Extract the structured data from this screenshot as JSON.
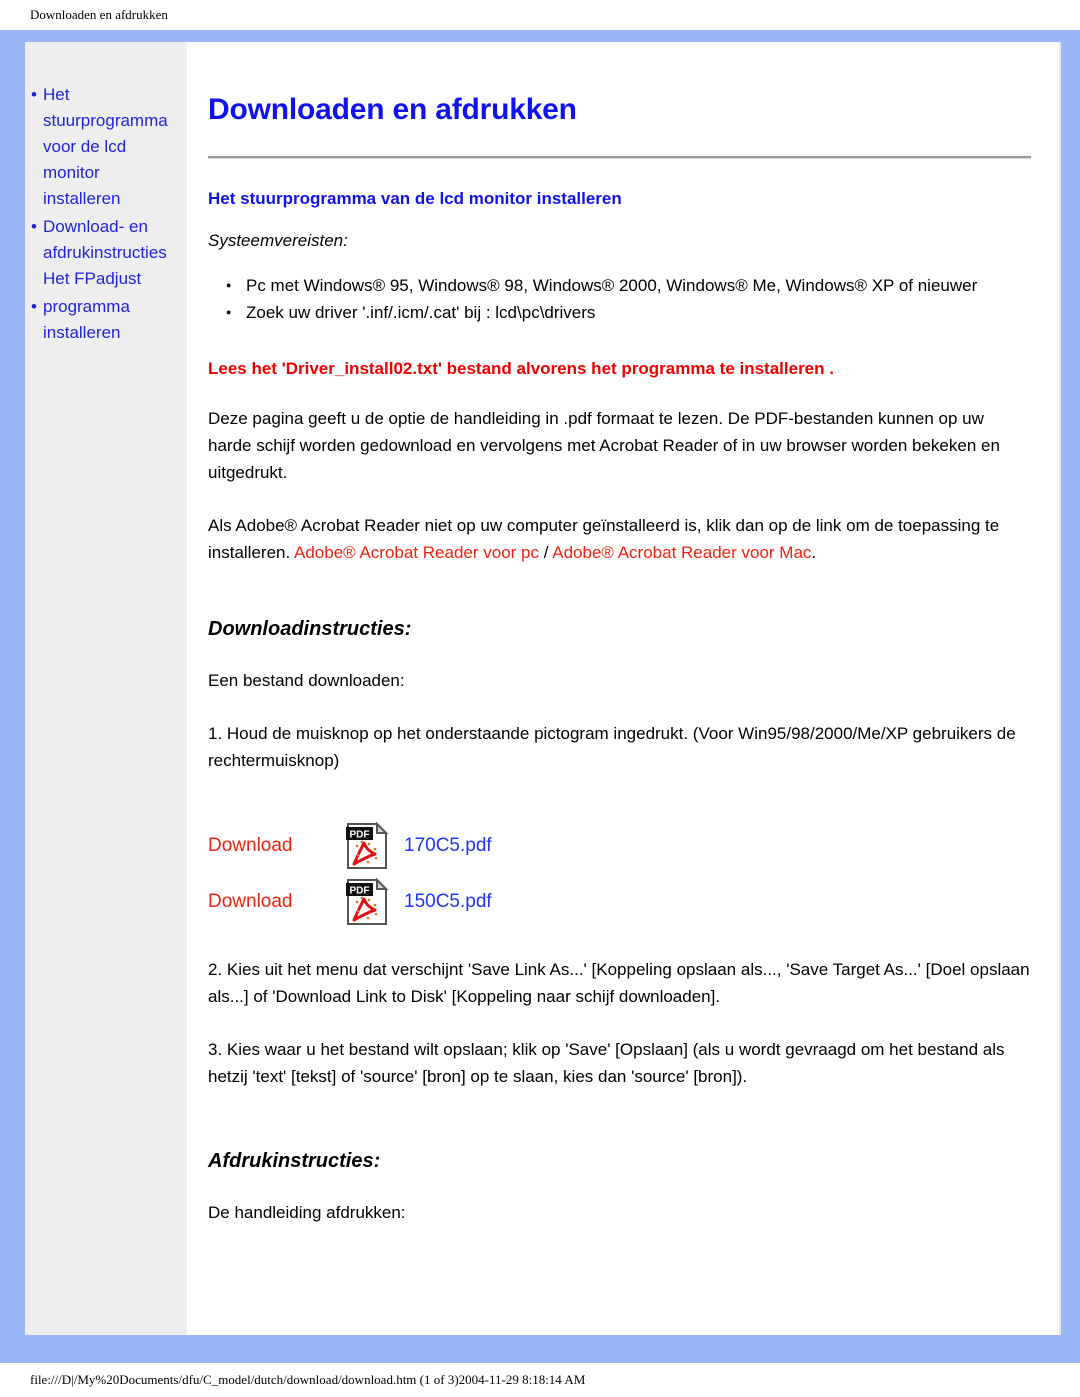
{
  "print_header": {
    "title": "Downloaden en afdrukken"
  },
  "sidebar": {
    "items": [
      {
        "label": "Het\nstuurprogramma\nvoor de lcd\nmonitor\ninstalleren",
        "bullet": "•"
      },
      {
        "label": "Download- en\nafdrukinstructies\nHet FPadjust",
        "bullet": "•"
      },
      {
        "label": "programma\ninstalleren",
        "bullet": "•"
      }
    ]
  },
  "main": {
    "page_title": "Downloaden en afdrukken",
    "section_title": "Het stuurprogramma van de lcd monitor installeren",
    "sysreq_label": "Systeemvereisten:",
    "requirements": [
      "Pc met Windows® 95, Windows® 98, Windows® 2000, Windows® Me, Windows® XP of nieuwer",
      "Zoek uw driver '.inf/.icm/.cat' bij : lcd\\pc\\drivers"
    ],
    "warning": "Lees het 'Driver_install02.txt' bestand alvorens het programma te installeren .",
    "paragraph_1": "Deze pagina geeft u de optie de handleiding in .pdf formaat te lezen. De PDF-bestanden kunnen op uw harde schijf worden gedownload en vervolgens met Acrobat Reader of in uw browser worden bekeken en uitgedrukt.",
    "paragraph_2_pre": "Als Adobe® Acrobat Reader niet op uw computer geïnstalleerd is, klik dan op de link om de toepassing te installeren. ",
    "link_pc": "Adobe® Acrobat Reader voor pc",
    "link_separator": " / ",
    "link_mac": "Adobe® Acrobat Reader voor Mac",
    "paragraph_2_post": ".",
    "download_heading": "Downloadinstructies:",
    "download_intro": "Een bestand downloaden:",
    "step_1": "1. Houd de muisknop op het onderstaande pictogram ingedrukt. (Voor Win95/98/2000/Me/XP gebruikers de rechtermuisknop)",
    "downloads": [
      {
        "action_label": "Download",
        "icon": "pdf-file-icon",
        "file_name": "170C5.pdf"
      },
      {
        "action_label": "Download",
        "icon": "pdf-file-icon",
        "file_name": "150C5.pdf"
      }
    ],
    "step_2": "2. Kies uit het menu dat verschijnt 'Save Link As...' [Koppeling opslaan als..., 'Save Target As...' [Doel opslaan als...] of 'Download Link to Disk' [Koppeling naar schijf downloaden].",
    "step_3": "3. Kies waar u het bestand wilt opslaan; klik op 'Save' [Opslaan] (als u wordt gevraagd om het bestand als hetzij 'text' [tekst] of 'source' [bron] op te slaan, kies dan 'source' [bron]).",
    "print_heading": "Afdrukinstructies:",
    "print_intro": "De handleiding afdrukken:"
  },
  "footer": {
    "path_text": "file:///D|/My%20Documents/dfu/C_model/dutch/download/download.htm (1 of 3)2004-11-29 8:18:14 AM"
  },
  "colors": {
    "frame_blue": "#9ab6f7",
    "heading_blue": "#1111ee",
    "link_blue": "#2233ee",
    "warning_red": "#ee0000",
    "link_red": "#ee2211",
    "sidebar_gray": "#eeeeee"
  }
}
